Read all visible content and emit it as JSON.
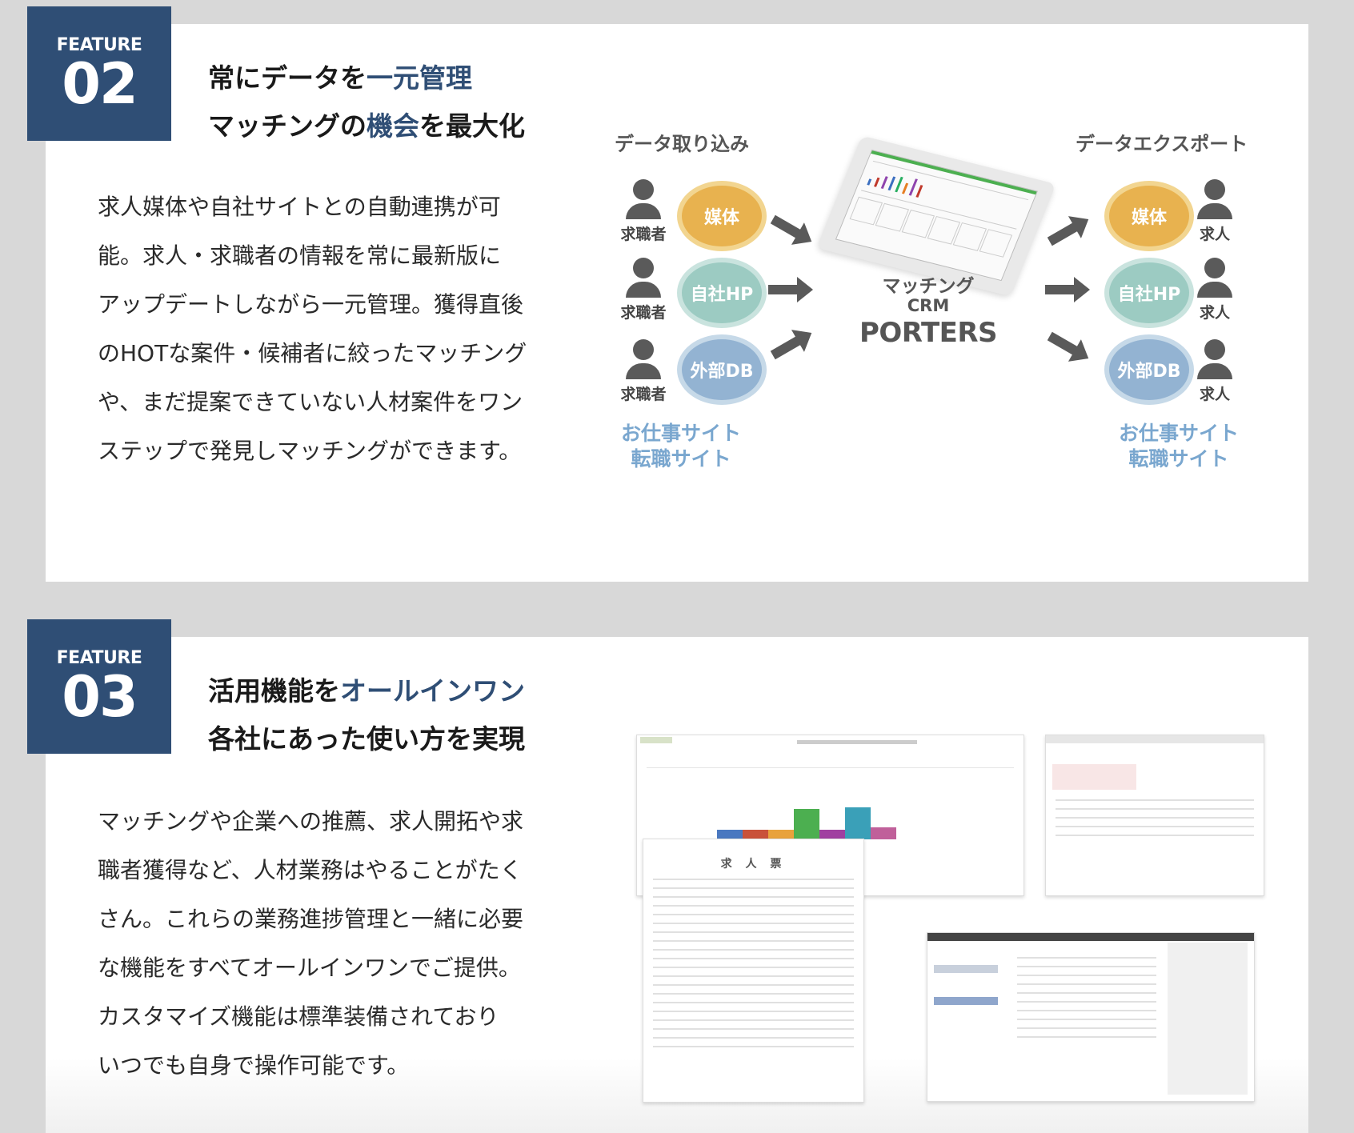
{
  "feature2": {
    "badge_label": "FEATURE",
    "badge_number": "02",
    "title_line1_plain": "常にデータを",
    "title_line1_highlight": "一元管理",
    "title_line2_pre": "マッチングの",
    "title_line2_highlight": "機会",
    "title_line2_post": "を最大化",
    "body_lines": [
      "求人媒体や自社サイトとの自動連携が可",
      "能。求人・求職者の情報を常に最新版に",
      "アップデートしながら一元管理。獲得直後",
      "のHOTな案件・候補者に絞ったマッチング",
      "や、まだ提案できていない人材案件をワン",
      "ステップで発見しマッチングができます。"
    ],
    "diagram": {
      "import_heading": "データ取り込み",
      "export_heading": "データエクスポート",
      "import_person_label": "求職者",
      "export_person_label": "求人",
      "sources": [
        "媒体",
        "自社HP",
        "外部DB"
      ],
      "sites_line1": "お仕事サイト",
      "sites_line2": "転職サイト",
      "crm_line1": "マッチング",
      "crm_line2": "CRM",
      "crm_line3": "PORTERS",
      "colors": {
        "media": "#e8b24f",
        "hp": "#9ccbc2",
        "db": "#93b3d2",
        "accent": "#2f4e75",
        "sites": "#7aa7cf"
      }
    }
  },
  "feature3": {
    "badge_label": "FEATURE",
    "badge_number": "03",
    "title_line1_plain": "活用機能を",
    "title_line1_highlight": "オールインワン",
    "title_line2": "各社にあった使い方を実現",
    "body_lines": [
      "マッチングや企業への推薦、求人開拓や求",
      "職者獲得など、人材業務はやることがたく",
      "さん。これらの業務進捗管理と一緒に必要",
      "な機能をすべてオールインワンでご提供。",
      "カスタマイズ機能は標準装備されており",
      "いつでも自身で操作可能です。"
    ],
    "screenshot_doc_title": "求 人 票"
  }
}
